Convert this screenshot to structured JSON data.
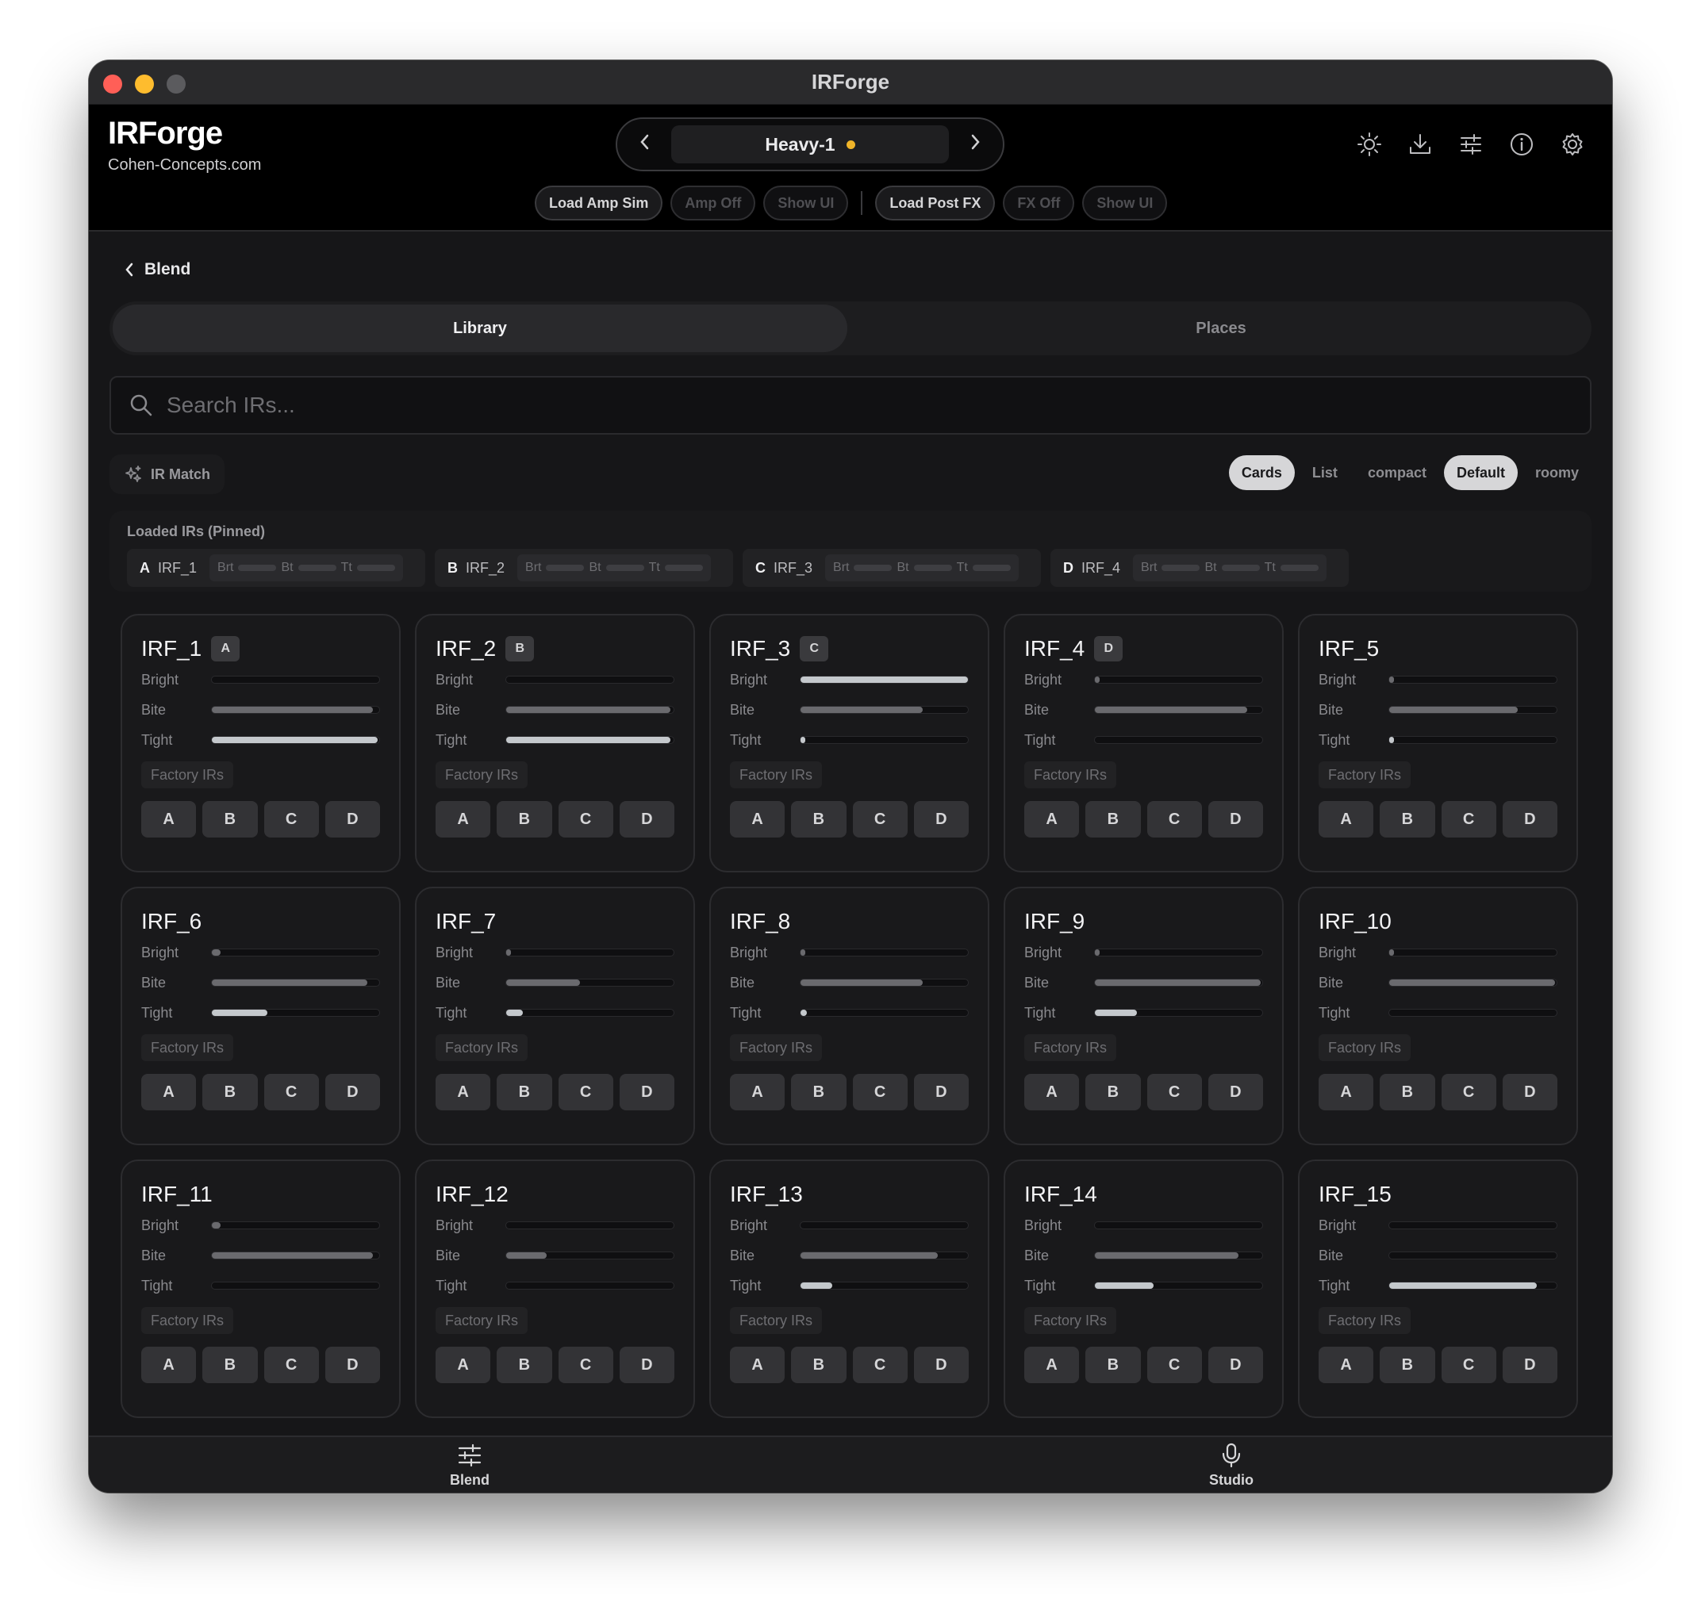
{
  "window": {
    "title": "IRForge"
  },
  "brand": {
    "name": "IRForge",
    "site": "Cohen-Concepts.com"
  },
  "preset": {
    "name": "Heavy-1",
    "modified_color": "#f0b429"
  },
  "header_icons": [
    "brightness-icon",
    "download-icon",
    "sliders-icon",
    "info-icon",
    "gear-icon"
  ],
  "fx": {
    "load_amp": "Load Amp Sim",
    "amp_off": "Amp Off",
    "show_ui_1": "Show UI",
    "load_post": "Load Post FX",
    "fx_off": "FX Off",
    "show_ui_2": "Show UI"
  },
  "nav": {
    "back_label": "Blend"
  },
  "tabs": [
    {
      "label": "Library",
      "active": true
    },
    {
      "label": "Places",
      "active": false
    }
  ],
  "search": {
    "placeholder": "Search IRs..."
  },
  "ir_match": "IR Match",
  "view_options": [
    {
      "label": "Cards",
      "active": true
    },
    {
      "label": "List",
      "active": false
    },
    {
      "label": "compact",
      "active": false
    },
    {
      "label": "Default",
      "active": true
    },
    {
      "label": "roomy",
      "active": false
    }
  ],
  "pinned": {
    "title": "Loaded IRs (Pinned)",
    "meter_labels": {
      "bright": "Brt",
      "bite": "Bt",
      "tight": "Tt"
    },
    "items": [
      {
        "slot": "A",
        "name": "IRF_1"
      },
      {
        "slot": "B",
        "name": "IRF_2"
      },
      {
        "slot": "C",
        "name": "IRF_3"
      },
      {
        "slot": "D",
        "name": "IRF_4"
      }
    ]
  },
  "meter_labels": {
    "bright": "Bright",
    "bite": "Bite",
    "tight": "Tight"
  },
  "slot_labels": [
    "A",
    "B",
    "C",
    "D"
  ],
  "cards": [
    {
      "name": "IRF_1",
      "badge": "A",
      "bright": 0.0,
      "bite": 0.96,
      "tight": 0.99,
      "tag": "Factory IRs"
    },
    {
      "name": "IRF_2",
      "badge": "B",
      "bright": 0.0,
      "bite": 0.98,
      "tight": 0.98,
      "tag": "Factory IRs"
    },
    {
      "name": "IRF_3",
      "badge": "C",
      "bright": 1.0,
      "bite": 0.73,
      "tight": 0.01,
      "tag": "Factory IRs"
    },
    {
      "name": "IRF_4",
      "badge": "D",
      "bright": 0.01,
      "bite": 0.91,
      "tight": 0.0,
      "tag": "Factory IRs"
    },
    {
      "name": "IRF_5",
      "badge": "",
      "bright": 0.02,
      "bite": 0.77,
      "tight": 0.01,
      "tag": "Factory IRs"
    },
    {
      "name": "IRF_6",
      "badge": "",
      "bright": 0.05,
      "bite": 0.93,
      "tight": 0.33,
      "tag": "Factory IRs"
    },
    {
      "name": "IRF_7",
      "badge": "",
      "bright": 0.01,
      "bite": 0.44,
      "tight": 0.1,
      "tag": "Factory IRs"
    },
    {
      "name": "IRF_8",
      "badge": "",
      "bright": 0.01,
      "bite": 0.73,
      "tight": 0.04,
      "tag": "Factory IRs"
    },
    {
      "name": "IRF_9",
      "badge": "",
      "bright": 0.03,
      "bite": 0.99,
      "tight": 0.25,
      "tag": "Factory IRs"
    },
    {
      "name": "IRF_10",
      "badge": "",
      "bright": 0.01,
      "bite": 0.99,
      "tight": 0.0,
      "tag": "Factory IRs"
    },
    {
      "name": "IRF_11",
      "badge": "",
      "bright": 0.05,
      "bite": 0.96,
      "tight": 0.0,
      "tag": "Factory IRs"
    },
    {
      "name": "IRF_12",
      "badge": "",
      "bright": 0.0,
      "bite": 0.24,
      "tight": 0.0,
      "tag": "Factory IRs"
    },
    {
      "name": "IRF_13",
      "badge": "",
      "bright": 0.0,
      "bite": 0.82,
      "tight": 0.19,
      "tag": "Factory IRs"
    },
    {
      "name": "IRF_14",
      "badge": "",
      "bright": 0.0,
      "bite": 0.86,
      "tight": 0.35,
      "tag": "Factory IRs"
    },
    {
      "name": "IRF_15",
      "badge": "",
      "bright": 0.0,
      "bite": 0.0,
      "tight": 0.88,
      "tag": "Factory IRs"
    }
  ],
  "bottom_tabs": [
    {
      "label": "Blend",
      "icon": "sliders-icon"
    },
    {
      "label": "Studio",
      "icon": "microphone-icon"
    }
  ]
}
